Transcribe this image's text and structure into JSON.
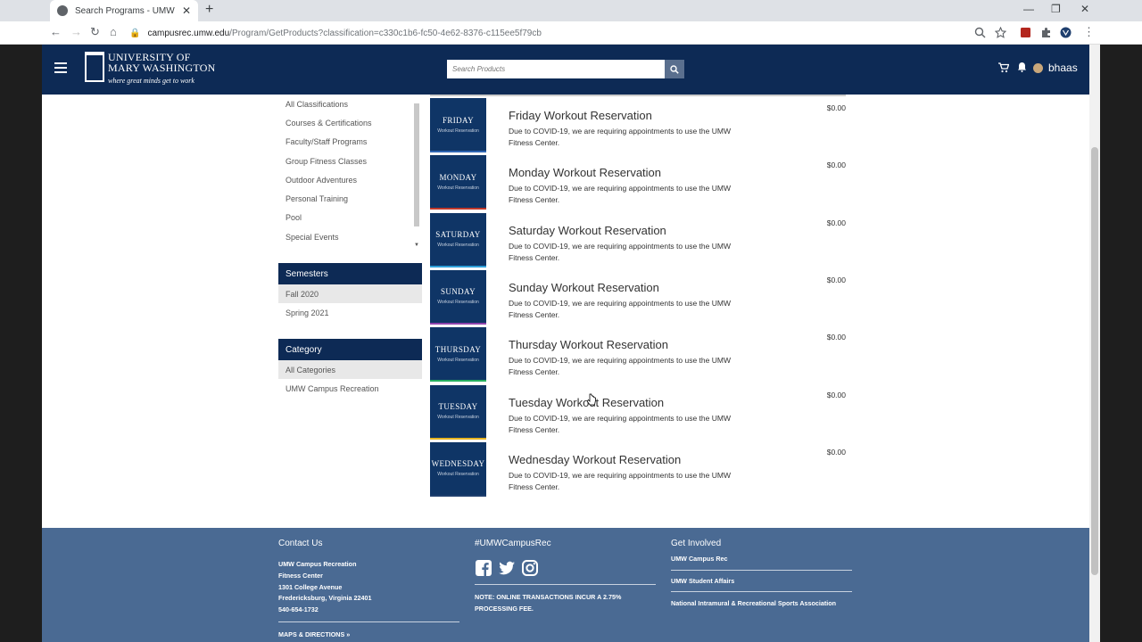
{
  "browser": {
    "tab_title": "Search Programs - UMW Campus Recreation",
    "new_tab": "+",
    "url_host": "campusrec.umw.edu",
    "url_path": "/Program/GetProducts?classification=c330c1b6-fc50-4e62-8376-c115ee5f79cb"
  },
  "header": {
    "logo_line1": "UNIVERSITY OF",
    "logo_line2": "MARY WASHINGTON",
    "logo_tagline": "where great minds get to work",
    "search_placeholder": "Search Products",
    "username": "bhaas"
  },
  "classifications": [
    "All Classifications",
    "Courses & Certifications",
    "Faculty/Staff Programs",
    "Group Fitness Classes",
    "Outdoor Adventures",
    "Personal Training",
    "Pool",
    "Special Events"
  ],
  "semesters": {
    "title": "Semesters",
    "options": [
      "Fall 2020",
      "Spring 2021"
    ]
  },
  "category": {
    "title": "Category",
    "options": [
      "All Categories",
      "UMW Campus Recreation"
    ]
  },
  "products": [
    {
      "day": "FRIDAY",
      "thumb_sub": "Workout Reservation",
      "title": "Friday Workout Reservation",
      "desc": "Due to COVID-19, we are requiring appointments to use the UMW Fitness Center.",
      "price": "$0.00",
      "accent": "#2e66b3"
    },
    {
      "day": "MONDAY",
      "thumb_sub": "Workout Reservation",
      "title": "Monday Workout Reservation",
      "desc": "Due to COVID-19, we are requiring appointments to use the UMW Fitness Center.",
      "price": "$0.00",
      "accent": "#c0392b"
    },
    {
      "day": "SATURDAY",
      "thumb_sub": "Workout Reservation",
      "title": "Saturday Workout Reservation",
      "desc": "Due to COVID-19, we are requiring appointments to use the UMW Fitness Center.",
      "price": "$0.00",
      "accent": "#2e9fd8"
    },
    {
      "day": "SUNDAY",
      "thumb_sub": "Workout Reservation",
      "title": "Sunday Workout Reservation",
      "desc": "Due to COVID-19, we are requiring appointments to use the UMW Fitness Center.",
      "price": "$0.00",
      "accent": "#8e44ad"
    },
    {
      "day": "THURSDAY",
      "thumb_sub": "Workout Reservation",
      "title": "Thursday Workout Reservation",
      "desc": "Due to COVID-19, we are requiring appointments to use the UMW Fitness Center.",
      "price": "$0.00",
      "accent": "#27ae60"
    },
    {
      "day": "TUESDAY",
      "thumb_sub": "Workout Reservation",
      "title": "Tuesday Workout Reservation",
      "desc": "Due to COVID-19, we are requiring appointments to use the UMW Fitness Center.",
      "price": "$0.00",
      "accent": "#e6b422"
    },
    {
      "day": "WEDNESDAY",
      "thumb_sub": "Workout Reservation",
      "title": "Wednesday Workout Reservation",
      "desc": "Due to COVID-19, we are requiring appointments to use the UMW Fitness Center.",
      "price": "$0.00",
      "accent": "#1f3f6e"
    }
  ],
  "footer": {
    "contact": {
      "title": "Contact Us",
      "lines": [
        "UMW Campus Recreation",
        "Fitness Center",
        "1301 College Avenue",
        "Fredericksburg, Virginia 22401",
        "540-654-1732"
      ],
      "maps_link": "MAPS & DIRECTIONS »"
    },
    "social": {
      "title": "#UMWCampusRec",
      "note": "NOTE: ONLINE TRANSACTIONS INCUR A 2.75% PROCESSING FEE."
    },
    "involved": {
      "title": "Get Involved",
      "links": [
        "UMW Campus Rec",
        "UMW Student Affairs",
        "National Intramural & Recreational Sports Association"
      ]
    }
  },
  "colors": {
    "navy": "#0d2a55",
    "footer": "#4a6a93"
  }
}
